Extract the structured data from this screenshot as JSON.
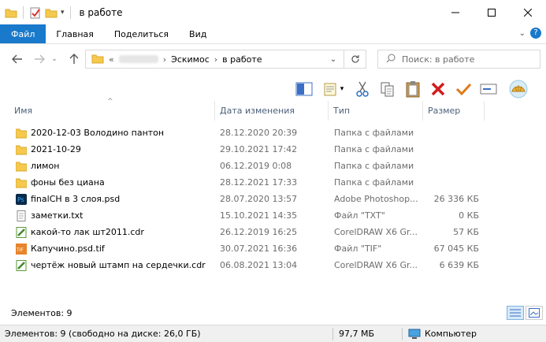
{
  "window": {
    "title": "в работе"
  },
  "ribbon": {
    "tabs": [
      "Файл",
      "Главная",
      "Поделиться",
      "Вид"
    ]
  },
  "address": {
    "prefix": "«",
    "hidden_segment": "",
    "segments": [
      "Эскимос",
      "в работе"
    ]
  },
  "search": {
    "placeholder": "Поиск: в работе"
  },
  "columns": {
    "name": "Имя",
    "date": "Дата изменения",
    "type": "Тип",
    "size": "Размер"
  },
  "files": [
    {
      "name": "2020-12-03 Володино пантон",
      "date": "28.12.2020 20:39",
      "type": "Папка с файлами",
      "size": "",
      "icon": "folder-icon"
    },
    {
      "name": "2021-10-29",
      "date": "29.10.2021 17:42",
      "type": "Папка с файлами",
      "size": "",
      "icon": "folder-icon"
    },
    {
      "name": "лимон",
      "date": "06.12.2019 0:08",
      "type": "Папка с файлами",
      "size": "",
      "icon": "folder-icon"
    },
    {
      "name": "фоны без циана",
      "date": "28.12.2021 17:33",
      "type": "Папка с файлами",
      "size": "",
      "icon": "folder-icon"
    },
    {
      "name": "finalCH в 3 слоя.psd",
      "date": "28.07.2020 13:57",
      "type": "Adobe Photoshop...",
      "size": "26 336 КБ",
      "icon": "photoshop-file-icon"
    },
    {
      "name": "заметки.txt",
      "date": "15.10.2021 14:35",
      "type": "Файл \"TXT\"",
      "size": "0 КБ",
      "icon": "text-file-icon"
    },
    {
      "name": "какой-то лак шт2011.cdr",
      "date": "26.12.2019 16:25",
      "type": "CorelDRAW X6 Gr...",
      "size": "57 КБ",
      "icon": "coreldraw-file-icon"
    },
    {
      "name": "Капучино.psd.tif",
      "date": "30.07.2021 16:36",
      "type": "Файл \"TIF\"",
      "size": "67 045 КБ",
      "icon": "tif-file-icon"
    },
    {
      "name": "чертёж новый штамп на сердечки.cdr",
      "date": "06.08.2021 13:04",
      "type": "CorelDRAW X6 Gr...",
      "size": "6 639 КБ",
      "icon": "coreldraw-file-icon"
    }
  ],
  "footer": {
    "count": "Элементов: 9"
  },
  "status": {
    "left": "Элементов: 9 (свободно на диске: 26,0 ГБ)",
    "middle": "97,7 МБ",
    "right": "Компьютер"
  },
  "colors": {
    "file_tab": "#1979ca",
    "header_text": "#4c607a",
    "folder": "#f5c94d"
  }
}
